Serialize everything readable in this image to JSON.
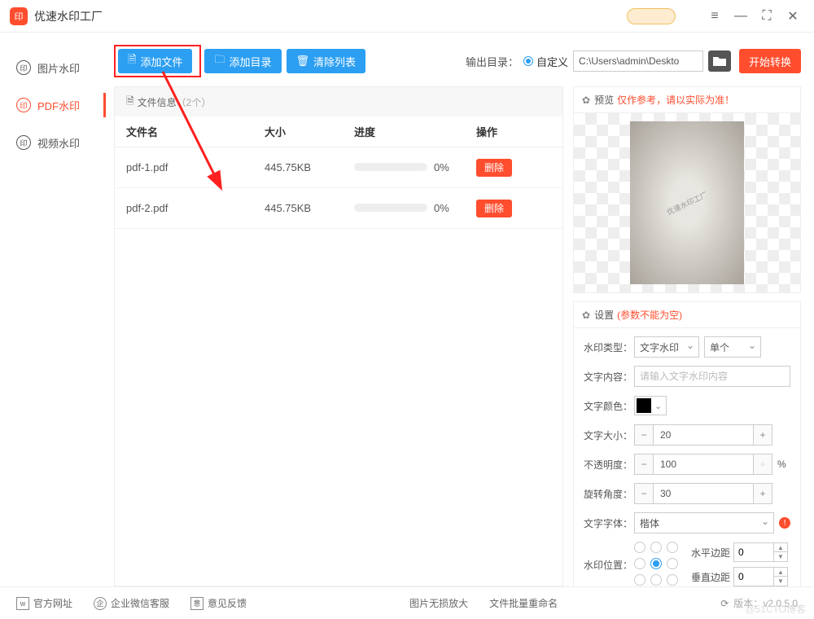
{
  "app": {
    "title": "优速水印工厂"
  },
  "sidebar": {
    "items": [
      {
        "label": "图片水印"
      },
      {
        "label": "PDF水印"
      },
      {
        "label": "视频水印"
      }
    ]
  },
  "toolbar": {
    "add_file": "添加文件",
    "add_dir": "添加目录",
    "clear": "清除列表",
    "output_label": "输出目录：",
    "radio_custom": "自定义",
    "path": "C:\\Users\\admin\\Deskto",
    "start": "开始转换"
  },
  "filelist": {
    "header": "文件信息",
    "count": "（2个）",
    "cols": {
      "name": "文件名",
      "size": "大小",
      "progress": "进度",
      "op": "操作"
    },
    "rows": [
      {
        "name": "pdf-1.pdf",
        "size": "445.75KB",
        "progress": "0%",
        "op": "删除"
      },
      {
        "name": "pdf-2.pdf",
        "size": "445.75KB",
        "progress": "0%",
        "op": "删除"
      }
    ]
  },
  "preview": {
    "title": "预览",
    "note": "仅作参考，请以实际为准！",
    "placeholder": "优速水印工厂"
  },
  "settings": {
    "title": "设置",
    "note": "(参数不能为空)",
    "type_label": "水印类型：",
    "type_value": "文字水印",
    "type_mode": "单个",
    "content_label": "文字内容：",
    "content_placeholder": "请输入文字水印内容",
    "color_label": "文字颜色：",
    "size_label": "文字大小：",
    "size_value": "20",
    "opacity_label": "不透明度：",
    "opacity_value": "100",
    "opacity_unit": "%",
    "rotate_label": "旋转角度：",
    "rotate_value": "30",
    "font_label": "文字字体：",
    "font_value": "楷体",
    "pos_label": "水印位置：",
    "hmargin_label": "水平边距",
    "hmargin_value": "0",
    "vmargin_label": "垂直边距",
    "vmargin_value": "0"
  },
  "footer": {
    "site": "官方网址",
    "wechat": "企业微信客服",
    "feedback": "意见反馈",
    "lossless": "图片无损放大",
    "rename": "文件批量重命名",
    "version_label": "版本：",
    "version": "v2.0.5.0"
  }
}
